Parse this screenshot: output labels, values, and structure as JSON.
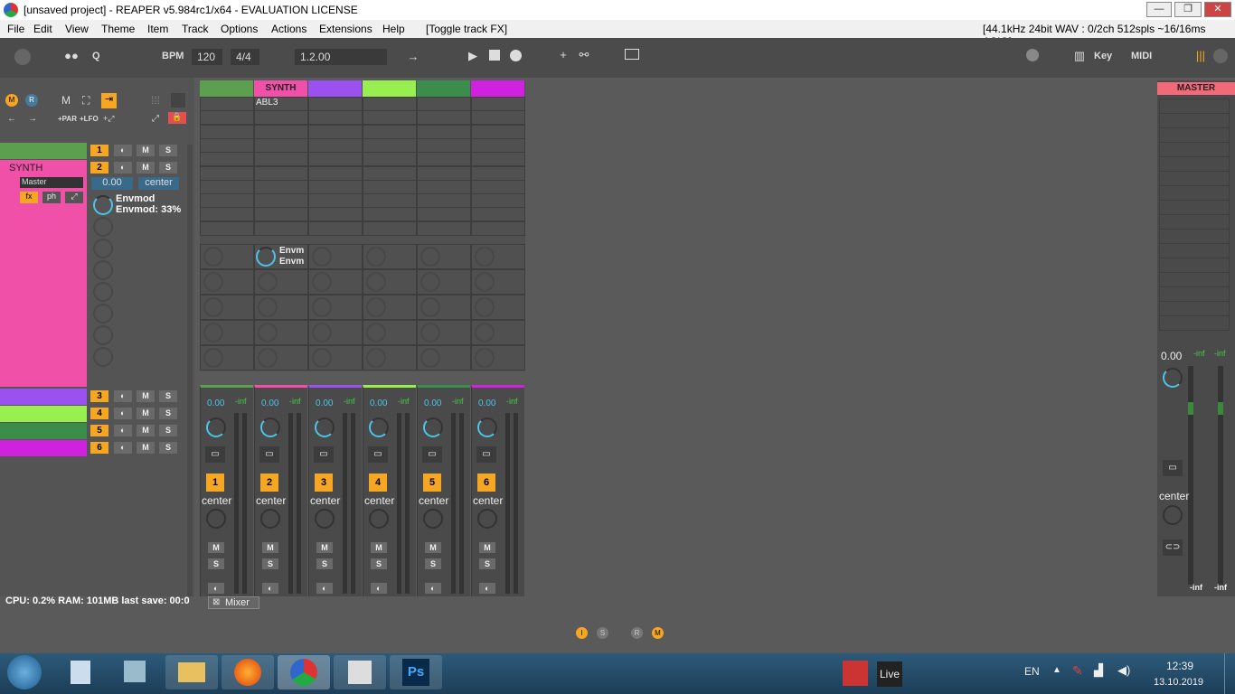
{
  "window": {
    "title": "[unsaved project] - REAPER v5.984rc1/x64 - EVALUATION LICENSE",
    "min": "—",
    "max": "❐",
    "close": "✕"
  },
  "menu": {
    "items": [
      "File",
      "Edit",
      "View",
      "Theme",
      "Item",
      "Track",
      "Options",
      "Actions",
      "Extensions",
      "Help",
      "[Toggle track FX]"
    ],
    "status": "[44.1kHz 24bit WAV : 0/2ch 512spls ~16/16ms ASIO]"
  },
  "toolbar": {
    "q": "Q",
    "bpm_label": "BPM",
    "bpm": "120",
    "timesig": "4/4",
    "position": "1.2.00",
    "key": "Key",
    "midi": "MIDI"
  },
  "left": {
    "m": "M",
    "r": "R",
    "par": "+PAR",
    "lfo": "+LFO",
    "synth_name": "SYNTH",
    "send": "Master",
    "vol": "0.00",
    "pan": "center",
    "fx": "fx",
    "ph": "ph",
    "param1": "Envmod",
    "param2": "Envmod: 33%",
    "btn_m": "M",
    "btn_s": "S"
  },
  "tracks": [
    {
      "num": "1",
      "color": "#5ca04f"
    },
    {
      "num": "2",
      "color": "#f050a8"
    },
    {
      "num": "3",
      "color": "#9b50f0"
    },
    {
      "num": "4",
      "color": "#98f050"
    },
    {
      "num": "5",
      "color": "#3c8c4c"
    },
    {
      "num": "6",
      "color": "#d020e0"
    }
  ],
  "grid": {
    "synth": "SYNTH",
    "abl3": "ABL3",
    "env1": "Envm",
    "env2": "Envm"
  },
  "mixer": {
    "vol": "0.00",
    "inf": "-inf",
    "pan": "center",
    "m": "M",
    "s": "S",
    "tab": "Mixer"
  },
  "master": {
    "label": "MASTER",
    "vol": "0.00",
    "inf1": "-inf",
    "inf2": "-inf",
    "pan": "center",
    "bot1": "-inf",
    "bot2": "-inf"
  },
  "status": {
    "text": "CPU: 0.2%  RAM: 101MB  last save: 00:0"
  },
  "bottom_icons": {
    "i": "I",
    "s": "S",
    "r": "R",
    "m": "M"
  },
  "taskbar": {
    "lang": "EN",
    "time": "12:39",
    "date": "13.10.2019",
    "live": "Live",
    "ps": "Ps"
  }
}
